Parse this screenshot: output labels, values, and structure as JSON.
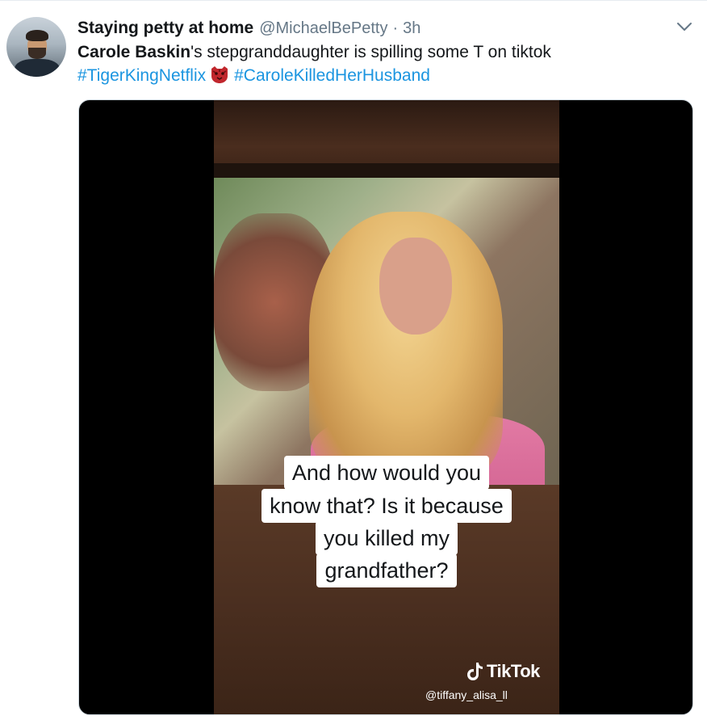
{
  "tweet": {
    "name": "Staying petty at home",
    "handle": "@MichaelBePetty",
    "separator": "·",
    "time": "3h",
    "text_bold": "Carole Baskin",
    "text_rest": "'s stepgranddaughter is spilling some T on tiktok",
    "hashtag_1": "#TigerKingNetflix",
    "emoji": "tiger-face-emoji",
    "hashtag_2": "#CaroleKilledHerHusband"
  },
  "media": {
    "caption_lines": [
      "And how would you",
      "know that? Is it because",
      "you killed my",
      "grandfather?"
    ],
    "watermark_brand": "TikTok",
    "watermark_user": "@tiffany_alisa_ll"
  },
  "icons": {
    "menu": "chevron-down-icon",
    "avatar": "user-avatar",
    "watermark": "tiktok-note-icon"
  },
  "colors": {
    "link": "#1b95e0",
    "secondary_text": "#657786",
    "primary_text": "#14171a",
    "border": "#ccd6dd"
  }
}
